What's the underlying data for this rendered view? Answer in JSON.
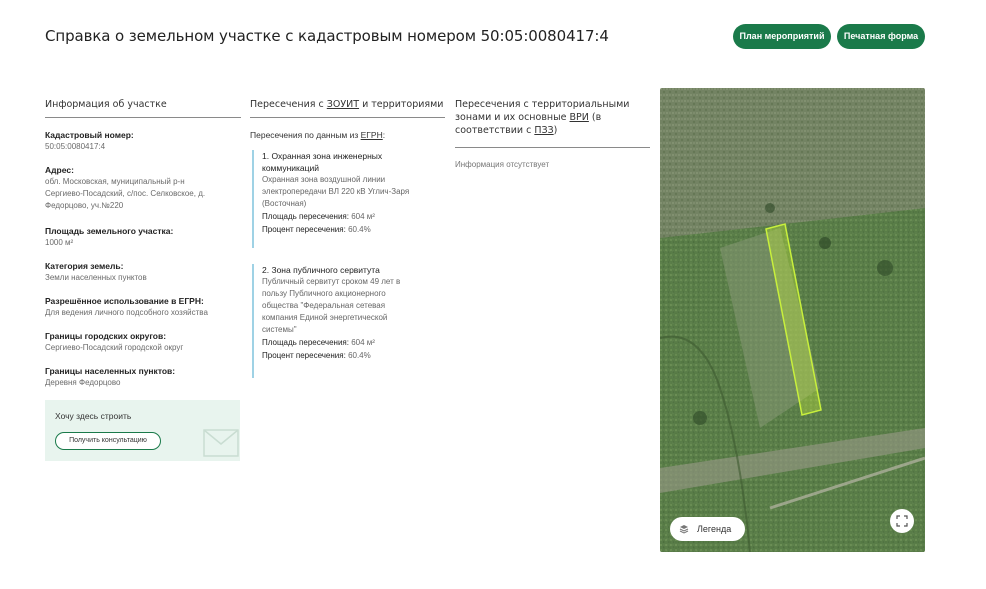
{
  "header": {
    "title": "Справка о земельном участке с кадастровым номером 50:05:0080417:4",
    "plan_button": "План мероприятий",
    "print_button": "Печатная форма"
  },
  "plot_info": {
    "heading": "Информация об участке",
    "fields": [
      {
        "label": "Кадастровый номер:",
        "value": "50:05:0080417:4"
      },
      {
        "label": "Адрес:",
        "value_lines": [
          "обл. Московская, муниципальный р-н",
          "Сергиево-Посадский, с/пос. Селковское, д.",
          "Федорцово, уч.№220"
        ]
      },
      {
        "label": "Площадь земельного участка:",
        "value": "1000 м²"
      },
      {
        "label": "Категория земель:",
        "value": "Земли населенных пунктов"
      },
      {
        "label": "Разрешённое использование в ЕГРН:",
        "value": "Для ведения личного подсобного хозяйства"
      },
      {
        "label": "Границы городских округов:",
        "value": "Сергиево-Посадский городской округ"
      },
      {
        "label": "Границы населенных пунктов:",
        "value": "Деревня Федорцово"
      }
    ],
    "build_box": {
      "title": "Хочу здесь строить",
      "button": "Получить консультацию"
    }
  },
  "intersections": {
    "heading_prefix": "Пересечения с ",
    "heading_link": "ЗОУИТ",
    "heading_suffix": " и территориями",
    "sub_prefix": "Пересечения по данным из ",
    "sub_link": "ЕГРН",
    "sub_suffix": ":",
    "zones": [
      {
        "title_lines": [
          "1. Охранная зона инженерных",
          "коммуникаций"
        ],
        "desc_lines": [
          "Охранная зона воздушной линии",
          "электропередачи ВЛ 220 кВ Углич-Заря",
          "(Восточная)"
        ],
        "area_label": "Площадь пересечения:",
        "area_value": "604 м²",
        "percent_label": "Процент пересечения:",
        "percent_value": "60.4%"
      },
      {
        "title_lines": [
          "2. Зона публичного сервитута"
        ],
        "desc_lines": [
          "Публичный сервитут сроком 49 лет в",
          "пользу Публичного акционерного",
          "общества \"Федеральная сетевая",
          "компания Единой энергетической",
          "системы\""
        ],
        "area_label": "Площадь пересечения:",
        "area_value": "604 м²",
        "percent_label": "Процент пересечения:",
        "percent_value": "60.4%"
      }
    ]
  },
  "territorial": {
    "heading_line1": "Пересечения с территориальными",
    "heading_line2_prefix": "зонами и их основные ",
    "heading_link1": "ВРИ",
    "heading_line2_suffix": " (в",
    "heading_line3_prefix": "соответствии с ",
    "heading_link2": "ПЗЗ",
    "heading_line3_suffix": ")",
    "info": "Информация отсутствует"
  },
  "map": {
    "legend_label": "Легенда",
    "plot_highlight_color": "#c8f03c"
  },
  "colors": {
    "accent": "#1a7a4a",
    "zone_border": "#9fd2e5",
    "build_box_bg": "#e8f4ee"
  }
}
